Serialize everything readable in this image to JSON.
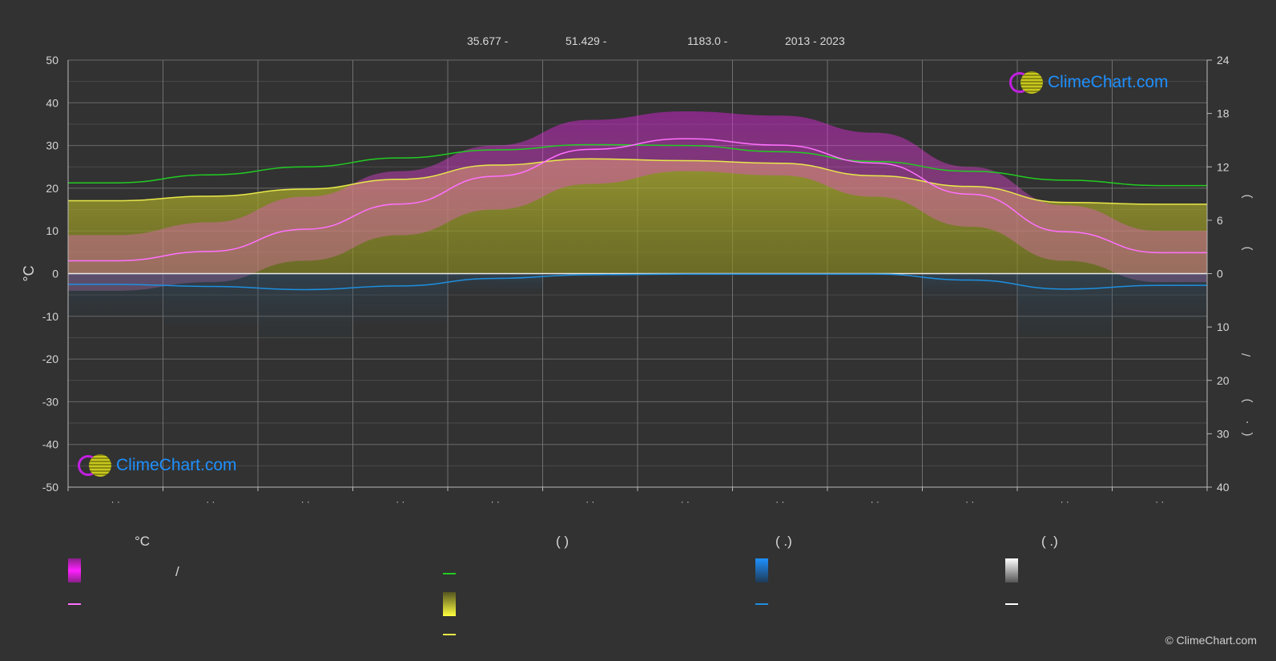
{
  "header": {
    "lat": "35.677 -",
    "lon": "51.429 -",
    "elev": "1183.0 -",
    "years": "2013 - 2023"
  },
  "axis": {
    "left_unit": "°C",
    "right_labels": [
      ")",
      ")",
      "/",
      ")",
      "·",
      "("
    ],
    "month_labels": [
      "· ·",
      "· ·",
      "· ·",
      "· ·",
      "· ·",
      "· ·",
      "· ·",
      "· ·",
      "· ·",
      "· ·",
      "· ·",
      "· ·"
    ]
  },
  "legend": {
    "col1_title": "°C",
    "col1_slash": "/",
    "col2_title": "(          )",
    "col3_title": "(   .)",
    "col4_title": "(   .)"
  },
  "logo": {
    "text": "ClimeChart.com"
  },
  "copyright": "© ClimeChart.com",
  "colors": {
    "background": "#323232",
    "daylight": "#22cc22",
    "sunshine": "#e8e84a",
    "temp_mean": "#ff70ff",
    "temp_range": "#d020d0",
    "rain": "#1e8fe0",
    "snow": "#d0d0d0",
    "grid": "#6a6a6a"
  },
  "chart_data": {
    "type": "line",
    "x": [
      1,
      2,
      3,
      4,
      5,
      6,
      7,
      8,
      9,
      10,
      11,
      12
    ],
    "y_left": {
      "label": "°C",
      "ylim": [
        -50,
        50
      ],
      "ticks": [
        50,
        40,
        30,
        20,
        10,
        0,
        -10,
        -20,
        -30,
        -40,
        -50
      ]
    },
    "y_right_top": {
      "ylim": [
        0,
        24
      ],
      "ticks": [
        24,
        18,
        12,
        6,
        0
      ]
    },
    "y_right_bottom": {
      "ylim": [
        0,
        40
      ],
      "ticks": [
        10,
        20,
        30,
        40
      ]
    },
    "series": [
      {
        "key": "daylight",
        "axis": "right_top",
        "values": [
          10.2,
          11.1,
          12.0,
          13.0,
          13.9,
          14.5,
          14.4,
          13.7,
          12.6,
          11.5,
          10.5,
          9.9
        ]
      },
      {
        "key": "sunshine",
        "axis": "right_top",
        "values": [
          8.2,
          8.7,
          9.5,
          10.6,
          12.2,
          12.9,
          12.7,
          12.4,
          11.0,
          9.8,
          8.0,
          7.8
        ]
      },
      {
        "key": "temp_mean",
        "axis": "left",
        "values": [
          3.0,
          5.2,
          10.4,
          16.3,
          22.8,
          29.1,
          31.6,
          30.1,
          25.9,
          18.6,
          9.8,
          4.9
        ]
      },
      {
        "key": "temp_max_band",
        "axis": "left",
        "values": [
          9,
          12,
          18,
          24,
          30,
          36,
          38,
          37,
          33,
          25,
          16,
          10
        ]
      },
      {
        "key": "temp_min_band",
        "axis": "left",
        "values": [
          -4,
          -2,
          3,
          9,
          15,
          21,
          24,
          23,
          18,
          11,
          3,
          -2
        ]
      },
      {
        "key": "rain",
        "axis": "right_bottom",
        "values": [
          2.0,
          2.4,
          3.0,
          2.3,
          0.9,
          0.2,
          0.1,
          0.1,
          0.1,
          1.2,
          2.9,
          2.2
        ]
      }
    ]
  }
}
